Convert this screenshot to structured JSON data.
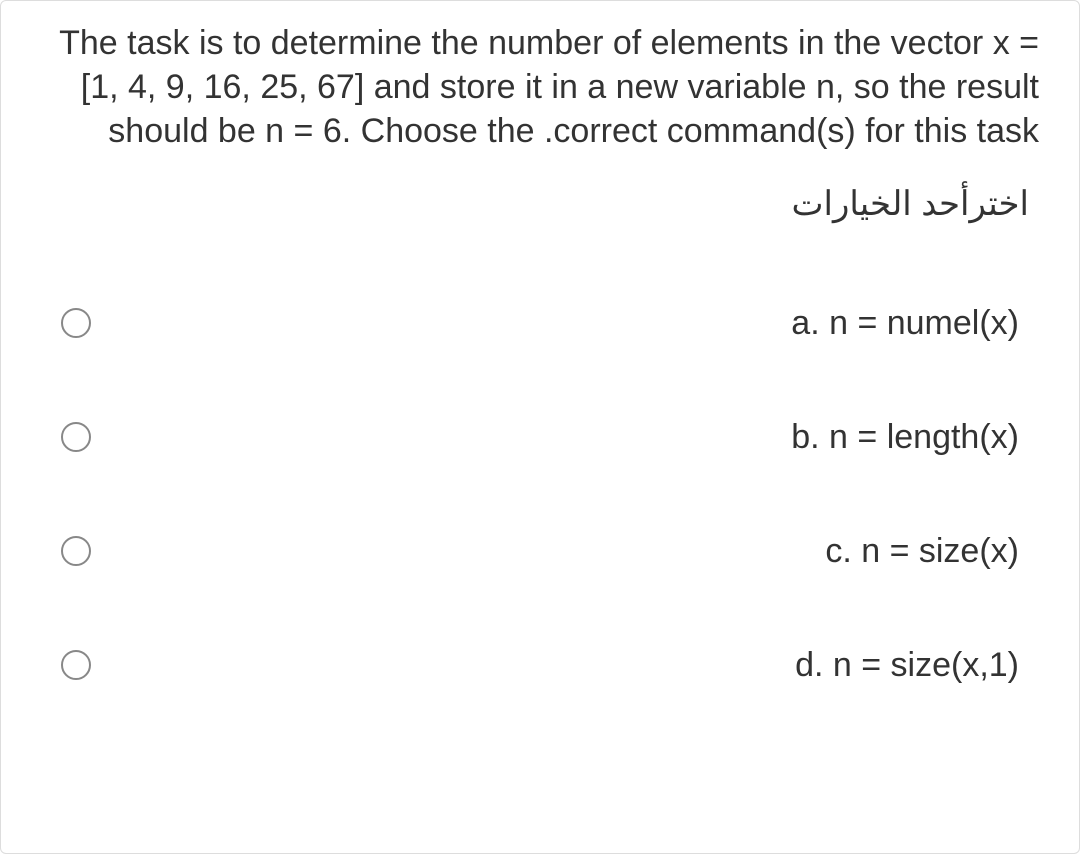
{
  "question": "The task is to determine the number of elements in the vector x = [1, 4, 9, 16, 25, 67] and store it in a new variable n, so the result should be n = 6. Choose the .correct command(s) for this task",
  "instruction": "اخترأحد الخيارات",
  "options": [
    {
      "label": "a. n = numel(x)"
    },
    {
      "label": "b. n = length(x)"
    },
    {
      "label": "c. n = size(x)"
    },
    {
      "label": "d. n = size(x,1)"
    }
  ]
}
